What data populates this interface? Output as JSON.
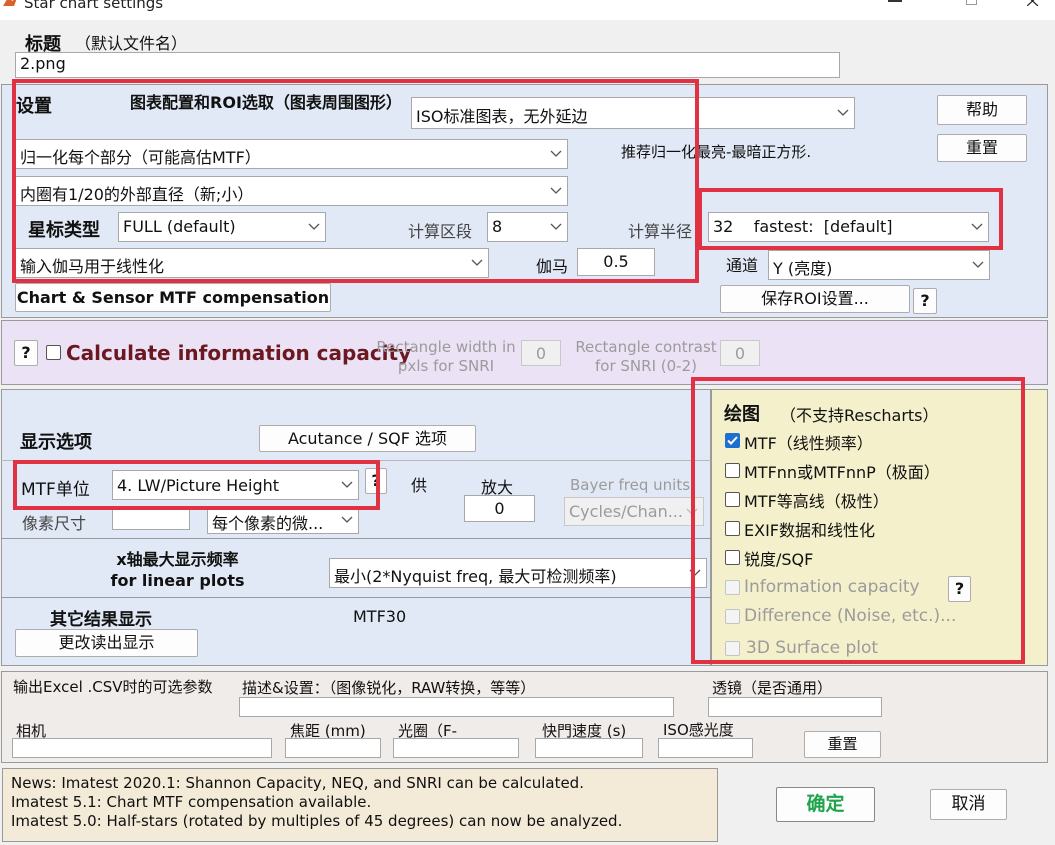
{
  "colors": {
    "window_bg": "#f0f0f0",
    "settings_bg": "#e2e9f6",
    "info_capacity_bg": "#ebe2f6",
    "plots_bg": "#f4f0cc",
    "news_bg": "#f3ead8",
    "annotation_red": "#e03243",
    "ok_green": "#1fa34b"
  },
  "window": {
    "title": "Star chart settings"
  },
  "title_section": {
    "label": "标题",
    "hint": "（默认文件名）",
    "value": "2.png"
  },
  "settings": {
    "label": "设置",
    "chart_config_label": "图表配置和ROI选取（图表周围图形）",
    "chart_config_value": "ISO标准图表，无外延边",
    "help_button": "帮助",
    "reset_button": "重置",
    "normalize_value": "归一化每个部分（可能高估MTF）",
    "normalize_hint": "推荐归一化最亮-最暗正方形.",
    "inner_circle_value": "内圈有1/20的外部直径（新;小）",
    "star_type_label": "星标类型",
    "star_type_value": "FULL (default)",
    "segments_label": "计算区段",
    "segments_value": "8",
    "radius_label": "计算半径",
    "radius_value": "32    fastest:  [default]",
    "gamma_select_value": "输入伽马用于线性化",
    "gamma_label": "伽马",
    "gamma_value": "0.5",
    "channel_label": "通道",
    "channel_value": "Y (亮度)",
    "compensation_button": "Chart & Sensor MTF compensation",
    "save_roi_button": "保存ROI设置...",
    "help_q": "?"
  },
  "info_capacity": {
    "help_q": "?",
    "checkbox_label": "Calculate information capacity",
    "checked": false,
    "rect_width_label": "Rectangle width in pxls for SNRI",
    "rect_width_value": "0",
    "rect_contrast_label": "Rectangle contrast for SNRI (0-2)",
    "rect_contrast_value": "0"
  },
  "display": {
    "label": "显示选项",
    "acutance_button": "Acutance / SQF 选项",
    "mtf_unit_label": "MTF单位",
    "mtf_unit_value": "4. LW/Picture Height",
    "mtf_unit_help": "?",
    "supply_label": "供",
    "zoom_label": "放大",
    "zoom_value": "0",
    "bayer_label": "Bayer freq units",
    "bayer_value": "Cycles/Chan...",
    "pixel_size_label": "像素尺寸",
    "pixel_size_value": "",
    "pixel_unit_value": "每个像素的微...",
    "xaxis_label_line1": "x轴最大显示频率",
    "xaxis_label_line2": "for linear plots",
    "xaxis_value": "最小(2*Nyquist freq, 最大可检测频率)",
    "other_results_label": "其它结果显示",
    "mtf30_label": "MTF30",
    "change_readout_button": "更改读出显示"
  },
  "plots": {
    "label": "绘图",
    "hint": "（不支持Rescharts）",
    "help_q": "?",
    "items": [
      {
        "label": "MTF（线性频率）",
        "checked": true,
        "disabled": false
      },
      {
        "label": "MTFnn或MTFnnP（极面）",
        "checked": false,
        "disabled": false
      },
      {
        "label": "MTF等高线（极性）",
        "checked": false,
        "disabled": false
      },
      {
        "label": "EXIF数据和线性化",
        "checked": false,
        "disabled": false
      },
      {
        "label": "锐度/SQF",
        "checked": false,
        "disabled": false
      },
      {
        "label": "Information capacity",
        "checked": false,
        "disabled": true
      },
      {
        "label": "Difference (Noise, etc.)...",
        "checked": false,
        "disabled": true
      },
      {
        "label": "3D Surface plot",
        "checked": false,
        "disabled": true
      }
    ]
  },
  "excel": {
    "label": "输出Excel .CSV时的可选参数",
    "description_label": "描述&设置：（图像锐化，RAW转换，等等）",
    "description_value": "",
    "lens_label": "透镜（是否通用）",
    "lens_value": "",
    "camera_label": "相机",
    "camera_value": "",
    "focal_label": "焦距 (mm)",
    "focal_value": "",
    "aperture_label": "光圈（F-",
    "aperture_value": "",
    "shutter_label": "快門速度 (s)",
    "shutter_value": "",
    "iso_label": "ISO感光度",
    "iso_value": "",
    "reset_button": "重置"
  },
  "news": {
    "lines": [
      "News:  Imatest 2020.1:  Shannon Capacity, NEQ, and SNRI can be calculated.",
      "Imatest 5.1:   Chart MTF compensation available.",
      "Imatest 5.0:   Half-stars (rotated by multiples of 45 degrees) can now be analyzed."
    ]
  },
  "footer": {
    "ok_button": "确定",
    "cancel_button": "取消"
  }
}
